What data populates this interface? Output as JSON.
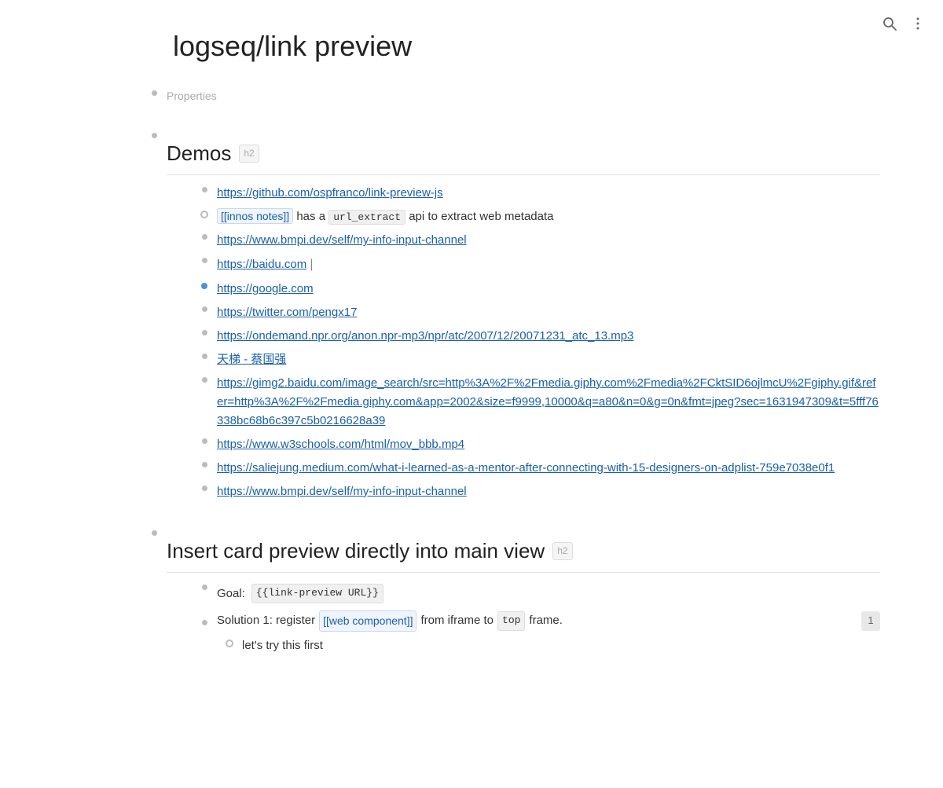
{
  "page": {
    "title": "logseq/link preview"
  },
  "toolbar": {
    "search_label": "search",
    "menu_label": "more options"
  },
  "properties_section": {
    "label": "Properties"
  },
  "demos_section": {
    "heading": "Demos",
    "badge": "h2",
    "divider": true,
    "items": [
      {
        "id": 1,
        "type": "link",
        "text": "https://github.com/ospfranco/link-preview-js",
        "url": "https://github.com/ospfranco/link-preview-js",
        "dot": "small"
      },
      {
        "id": 2,
        "type": "mixed",
        "dot": "outline",
        "parts": [
          {
            "type": "page-ref",
            "text": "[[innos notes]]"
          },
          {
            "type": "text",
            "text": " has a "
          },
          {
            "type": "code",
            "text": "url_extract"
          },
          {
            "type": "text",
            "text": " api to extract web metadata"
          }
        ]
      },
      {
        "id": 3,
        "type": "link",
        "text": "https://www.bmpi.dev/self/my-info-input-channel",
        "url": "https://www.bmpi.dev/self/my-info-input-channel",
        "dot": "small"
      },
      {
        "id": 4,
        "type": "link-cursor",
        "text": "https://baidu.com",
        "url": "https://baidu.com",
        "dot": "small",
        "show_cursor": true
      },
      {
        "id": 5,
        "type": "link",
        "text": "https://google.com",
        "url": "https://google.com",
        "dot": "blue"
      },
      {
        "id": 6,
        "type": "link",
        "text": "https://twitter.com/pengx17",
        "url": "https://twitter.com/pengx17",
        "dot": "small"
      },
      {
        "id": 7,
        "type": "link",
        "text": "https://ondemand.npr.org/anon.npr-mp3/npr/atc/2007/12/20071231_atc_13.mp3",
        "url": "https://ondemand.npr.org/anon.npr-mp3/npr/atc/2007/12/20071231_atc_13.mp3",
        "dot": "small"
      },
      {
        "id": 8,
        "type": "link",
        "text": "天梯 - 蔡国强",
        "url": "#",
        "dot": "small"
      },
      {
        "id": 9,
        "type": "link",
        "text": "https://gimg2.baidu.com/image_search/src=http%3A%2F%2Fmedia.giphy.com%2Fmedia%2FCktSID6ojlmcU%2Fgiphy.gif&refer=http%3A%2F%2Fmedia.giphy.com&app=2002&size=f9999,10000&q=a80&n=0&g=0n&fmt=jpeg?sec=1631947309&t=5fff76338bc68b6c397c5b0216628a39",
        "url": "#",
        "dot": "small"
      },
      {
        "id": 10,
        "type": "link",
        "text": "https://www.w3schools.com/html/mov_bbb.mp4",
        "url": "https://www.w3schools.com/html/mov_bbb.mp4",
        "dot": "small"
      },
      {
        "id": 11,
        "type": "link",
        "text": "https://saliejung.medium.com/what-i-learned-as-a-mentor-after-connecting-with-15-designers-on-adplist-759e7038e0f1",
        "url": "#",
        "dot": "small"
      },
      {
        "id": 12,
        "type": "link",
        "text": "https://www.bmpi.dev/self/my-info-input-channel",
        "url": "https://www.bmpi.dev/self/my-info-input-channel",
        "dot": "small"
      }
    ]
  },
  "insert_section": {
    "heading": "Insert card preview directly into main view",
    "badge": "h2",
    "goal_label": "Goal:",
    "goal_code": "{{link-preview URL}}",
    "solution_label": "Solution 1: register",
    "solution_page_ref": "[[web component]]",
    "solution_text_before": " from iframe to ",
    "solution_code": "top",
    "solution_text_after": " frame.",
    "solution_badge": "1",
    "sub_item": "let's try this first"
  }
}
